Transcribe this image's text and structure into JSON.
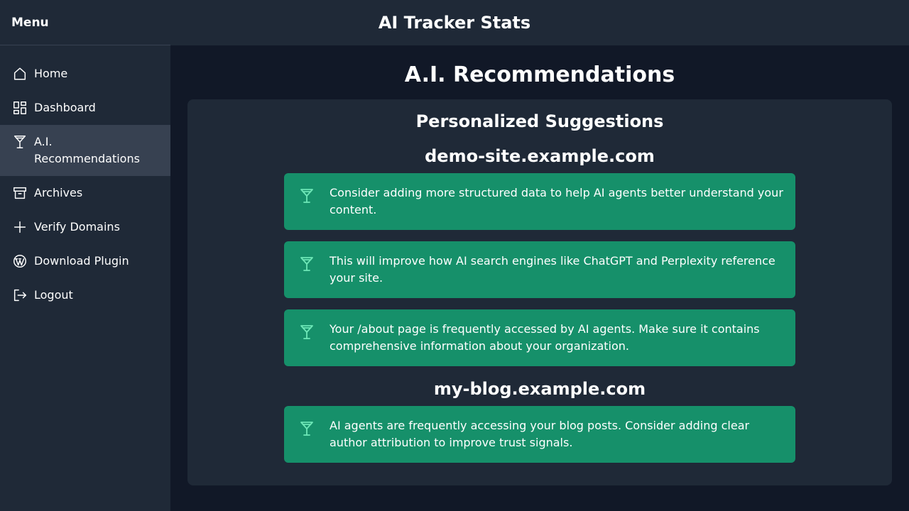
{
  "sidebar": {
    "title": "Menu",
    "items": [
      {
        "label": "Home",
        "icon": "home-icon"
      },
      {
        "label": "Dashboard",
        "icon": "dashboard-icon"
      },
      {
        "label": "A.I. Recommendations",
        "icon": "cocktail-glass-icon",
        "active": true
      },
      {
        "label": "Archives",
        "icon": "archive-icon"
      },
      {
        "label": "Verify Domains",
        "icon": "plus-icon"
      },
      {
        "label": "Download Plugin",
        "icon": "wordpress-icon"
      },
      {
        "label": "Logout",
        "icon": "logout-icon"
      }
    ]
  },
  "header": {
    "title": "AI Tracker Stats"
  },
  "main": {
    "title": "A.I. Recommendations",
    "panel_title": "Personalized Suggestions",
    "domains": [
      {
        "name": "demo-site.example.com",
        "recommendations": [
          "Consider adding more structured data to help AI agents better understand your content.",
          "This will improve how AI search engines like ChatGPT and Perplexity reference your site.",
          "Your /about page is frequently accessed by AI agents. Make sure it contains comprehensive information about your organization."
        ]
      },
      {
        "name": "my-blog.example.com",
        "recommendations": [
          "AI agents are frequently accessing your blog posts. Consider adding clear author attribution to improve trust signals."
        ]
      }
    ]
  },
  "colors": {
    "background": "#111827",
    "sidebar": "#1f2937",
    "active_item": "#374151",
    "card": "#16906a",
    "card_icon": "#6ee7b7"
  }
}
